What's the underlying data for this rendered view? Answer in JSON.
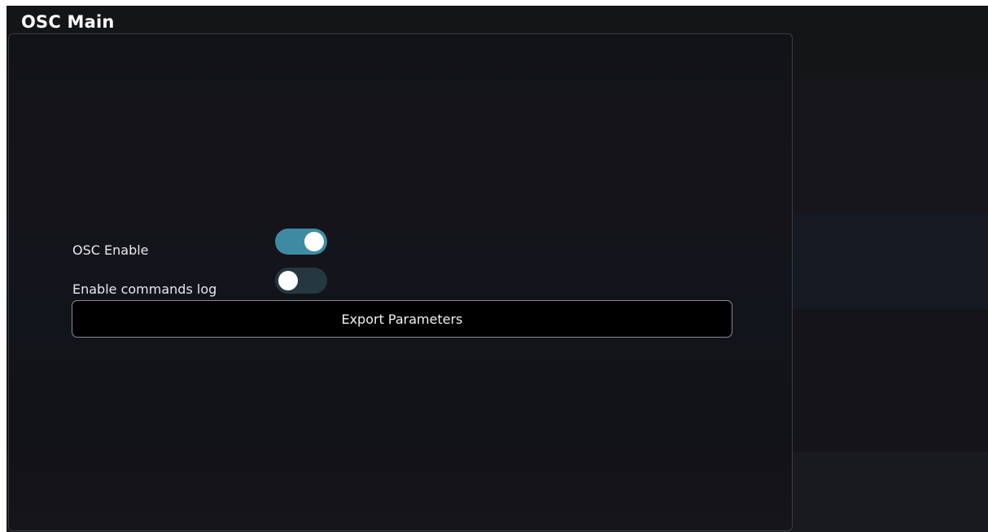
{
  "window": {
    "title": "OSC Main"
  },
  "settings": {
    "osc_enable": {
      "label": "OSC Enable",
      "enabled": true
    },
    "commands_log": {
      "label": "Enable commands log",
      "enabled": false
    }
  },
  "actions": {
    "export_label": "Export Parameters"
  },
  "colors": {
    "toggle_on": "#3f8aa3",
    "toggle_off": "#26383f",
    "background": "#141518"
  }
}
